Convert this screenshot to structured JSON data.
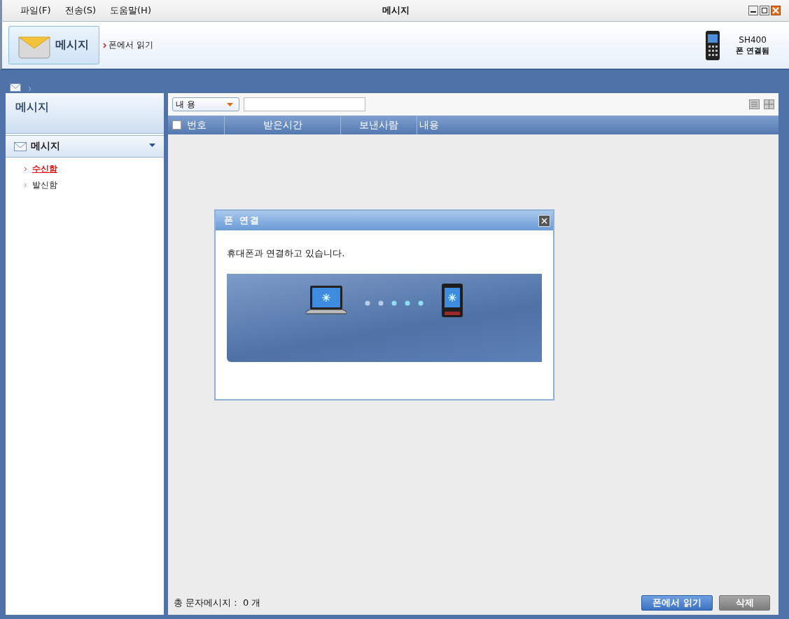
{
  "window": {
    "title": "메시지",
    "menu": [
      {
        "label": "파일(F)"
      },
      {
        "label": "전송(S)"
      },
      {
        "label": "도움말(H)"
      }
    ]
  },
  "header": {
    "app_button": {
      "label": "메시지",
      "selected": true
    },
    "link": "폰에서 읽기",
    "device": {
      "name": "SH400",
      "status": "폰 연결됨"
    }
  },
  "sidebar": {
    "title": "메시지",
    "section": {
      "label": "메시지",
      "expanded": true
    },
    "items": [
      {
        "label": "수신함",
        "selected": true
      },
      {
        "label": "발신함",
        "selected": false
      }
    ]
  },
  "toolbar": {
    "filter": {
      "value": "내 용"
    }
  },
  "table": {
    "select_all": {
      "checked": false
    },
    "columns": [
      {
        "label": "번호"
      },
      {
        "label": "받은시간"
      },
      {
        "label": "보낸사람"
      },
      {
        "label": "내용"
      }
    ]
  },
  "dialog": {
    "title": "폰 연결",
    "message": "휴대폰과 연결하고 있습니다."
  },
  "footer": {
    "total": "총 문자메시지 :  0 개",
    "buttons": [
      {
        "label": "폰에서 읽기",
        "disabled": false
      },
      {
        "label": "삭제",
        "disabled": true
      }
    ]
  }
}
